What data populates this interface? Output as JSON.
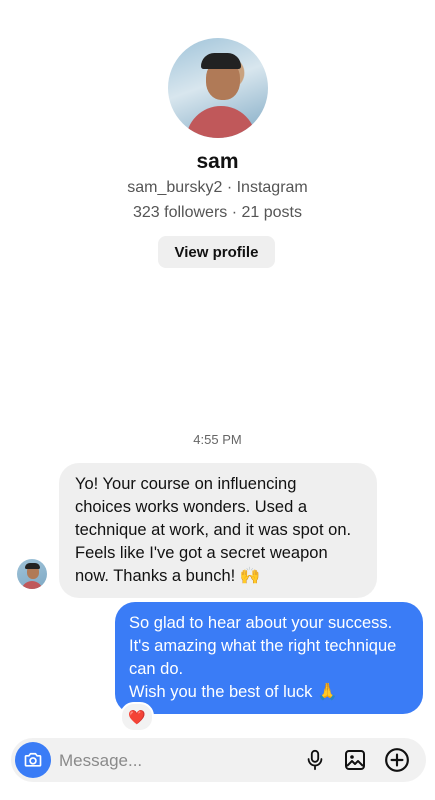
{
  "profile": {
    "name": "sam",
    "handle": "sam_bursky2 · Instagram",
    "stats": "323 followers · 21 posts",
    "view_profile_label": "View profile"
  },
  "conversation": {
    "timestamp": "4:55 PM",
    "incoming": {
      "lines": [
        "Yo! Your course on influencing",
        "choices works wonders. Used a",
        "technique at work, and it was spot on.",
        "Feels like I've got a secret weapon",
        "now. Thanks a bunch! 🙌"
      ]
    },
    "outgoing": {
      "lines": [
        "So glad to hear about your success.",
        "It's amazing what the right technique",
        "can do.",
        "Wish you the best of luck 🙏"
      ],
      "reaction": "❤️"
    }
  },
  "composer": {
    "placeholder": "Message...",
    "icons": [
      "camera-icon",
      "microphone-icon",
      "image-icon",
      "plus-circle-icon"
    ]
  },
  "colors": {
    "accent_blue": "#3a7cf6",
    "incoming_bubble": "#efefef",
    "composer_bg": "#f1f1f1"
  }
}
